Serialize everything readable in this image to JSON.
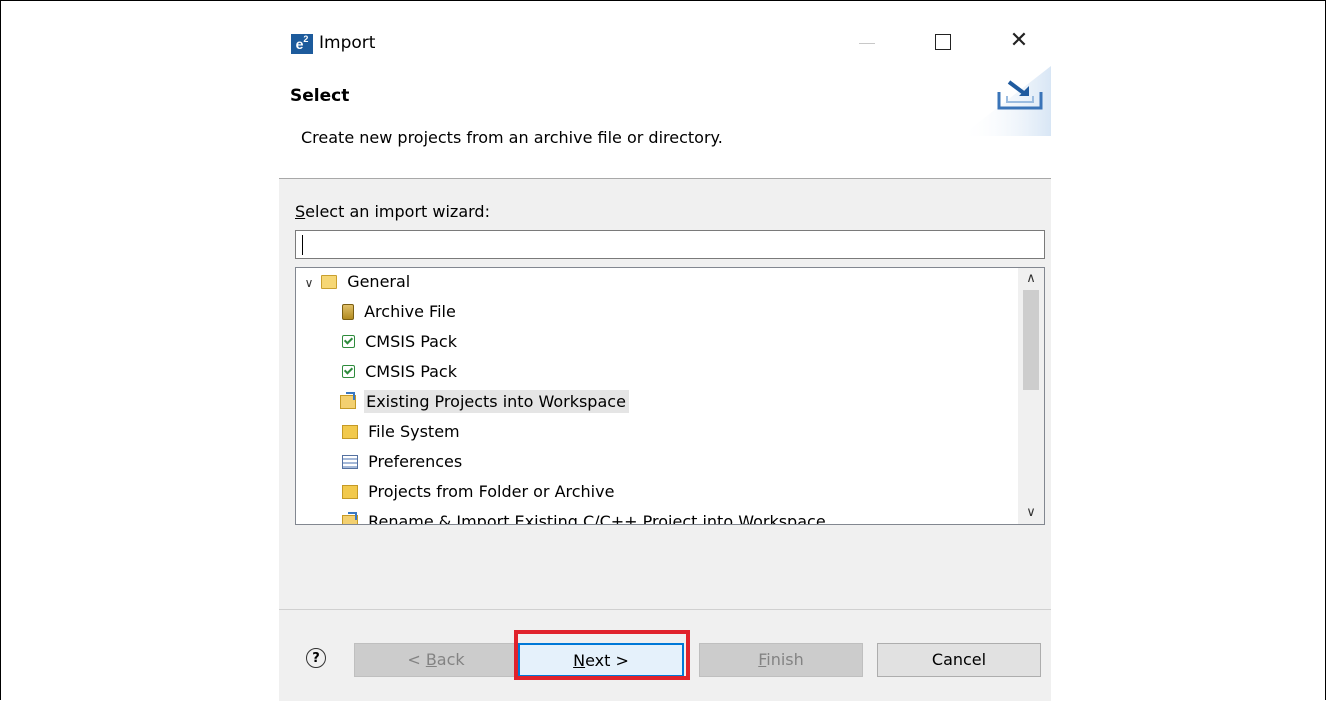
{
  "window": {
    "logo_text": "e",
    "logo_sup": "2",
    "title": "Import",
    "close_glyph": "✕"
  },
  "header": {
    "title": "Select",
    "description": "Create new projects from an archive file or directory.",
    "banner_icon": "import-tray-icon"
  },
  "body": {
    "wizard_label_prefix": "S",
    "wizard_label_rest": "elect an import wizard:",
    "filter_value": "",
    "tree": {
      "root": {
        "label": "General",
        "expanded": true,
        "icon": "folder-open-icon"
      },
      "items": [
        {
          "label": "Archive File",
          "icon": "archive-icon"
        },
        {
          "label": "CMSIS Pack",
          "icon": "check-icon"
        },
        {
          "label": "CMSIS Pack",
          "icon": "check-icon"
        },
        {
          "label": "Existing Projects into Workspace",
          "icon": "existing-projects-icon",
          "selected": true
        },
        {
          "label": "File System",
          "icon": "folder-icon"
        },
        {
          "label": "Preferences",
          "icon": "preferences-icon"
        },
        {
          "label": "Projects from Folder or Archive",
          "icon": "folder-icon"
        },
        {
          "label": "Rename & Import Existing C/C++ Project into Workspace",
          "icon": "existing-projects-icon"
        }
      ]
    }
  },
  "footer": {
    "help_glyph": "?",
    "back": {
      "prefix": "< ",
      "mnemonic": "B",
      "rest": "ack",
      "enabled": false
    },
    "next": {
      "mnemonic": "N",
      "rest": "ext >",
      "enabled": true,
      "highlighted": true
    },
    "finish": {
      "mnemonic": "F",
      "rest": "inish",
      "enabled": false
    },
    "cancel": {
      "label": "Cancel",
      "enabled": true
    }
  },
  "colors": {
    "highlight_border": "#e0222b",
    "default_button_border": "#0078d7",
    "logo_bg": "#1d5b9c"
  }
}
